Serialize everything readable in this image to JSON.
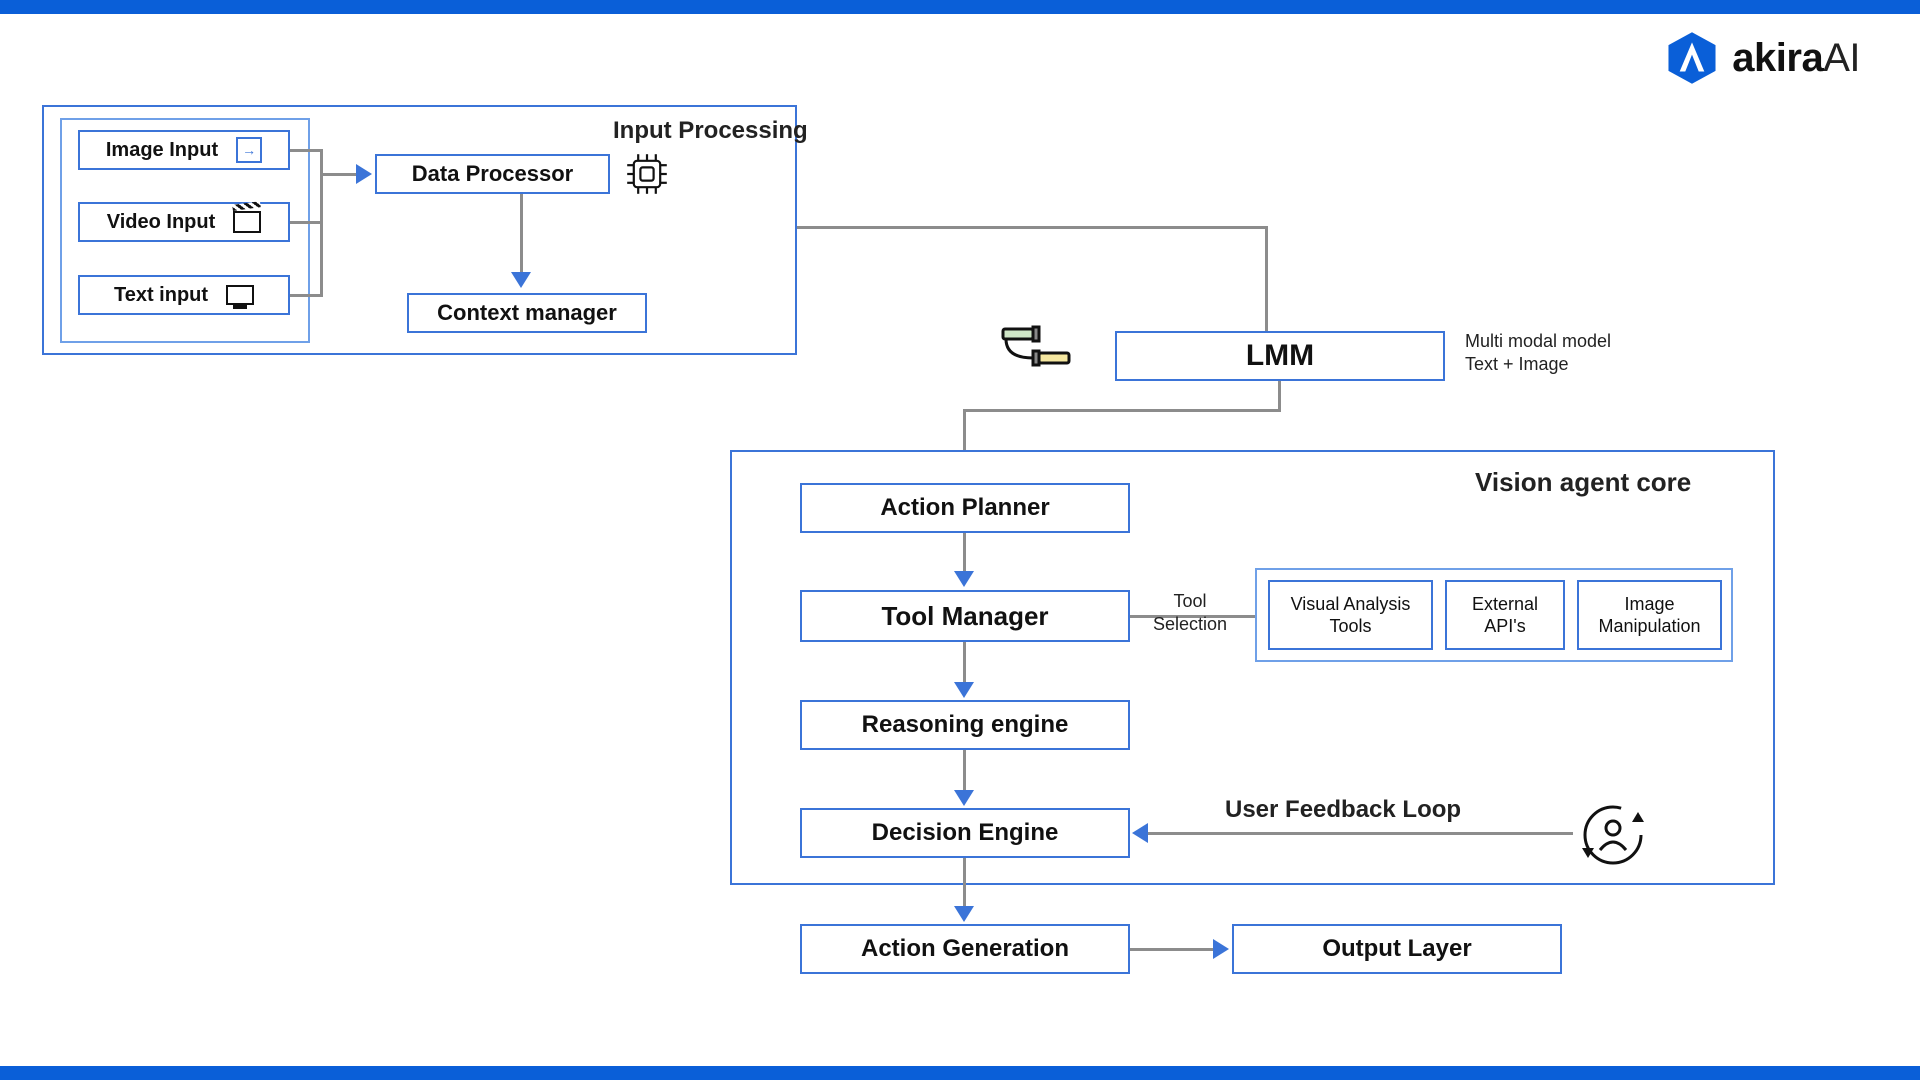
{
  "logo": {
    "brand": "akira",
    "suffix": "AI"
  },
  "inputProcessing": {
    "title": "Input Processing",
    "inputs": {
      "image": "Image Input",
      "video": "Video Input",
      "text": "Text input"
    },
    "dataProcessor": "Data Processor",
    "contextManager": "Context manager"
  },
  "lmm": {
    "label": "LMM",
    "caption_line1": "Multi modal model",
    "caption_line2": "Text + Image"
  },
  "visionCore": {
    "title": "Vision agent core",
    "actionPlanner": "Action Planner",
    "toolManager": "Tool Manager",
    "toolSelectionLabel_line1": "Tool",
    "toolSelectionLabel_line2": "Selection",
    "tools": {
      "visualAnalysis_line1": "Visual Analysis",
      "visualAnalysis_line2": "Tools",
      "externalApis_line1": "External",
      "externalApis_line2": "API's",
      "imageManipulation_line1": "Image",
      "imageManipulation_line2": "Manipulation"
    },
    "reasoningEngine": "Reasoning engine",
    "decisionEngine": "Decision Engine",
    "userFeedback": "User Feedback Loop"
  },
  "output": {
    "actionGeneration": "Action Generation",
    "outputLayer": "Output Layer"
  },
  "colors": {
    "brandBlue": "#0a5fd8",
    "boxBorder": "#3b74d8",
    "connector": "#8c8c8c"
  }
}
